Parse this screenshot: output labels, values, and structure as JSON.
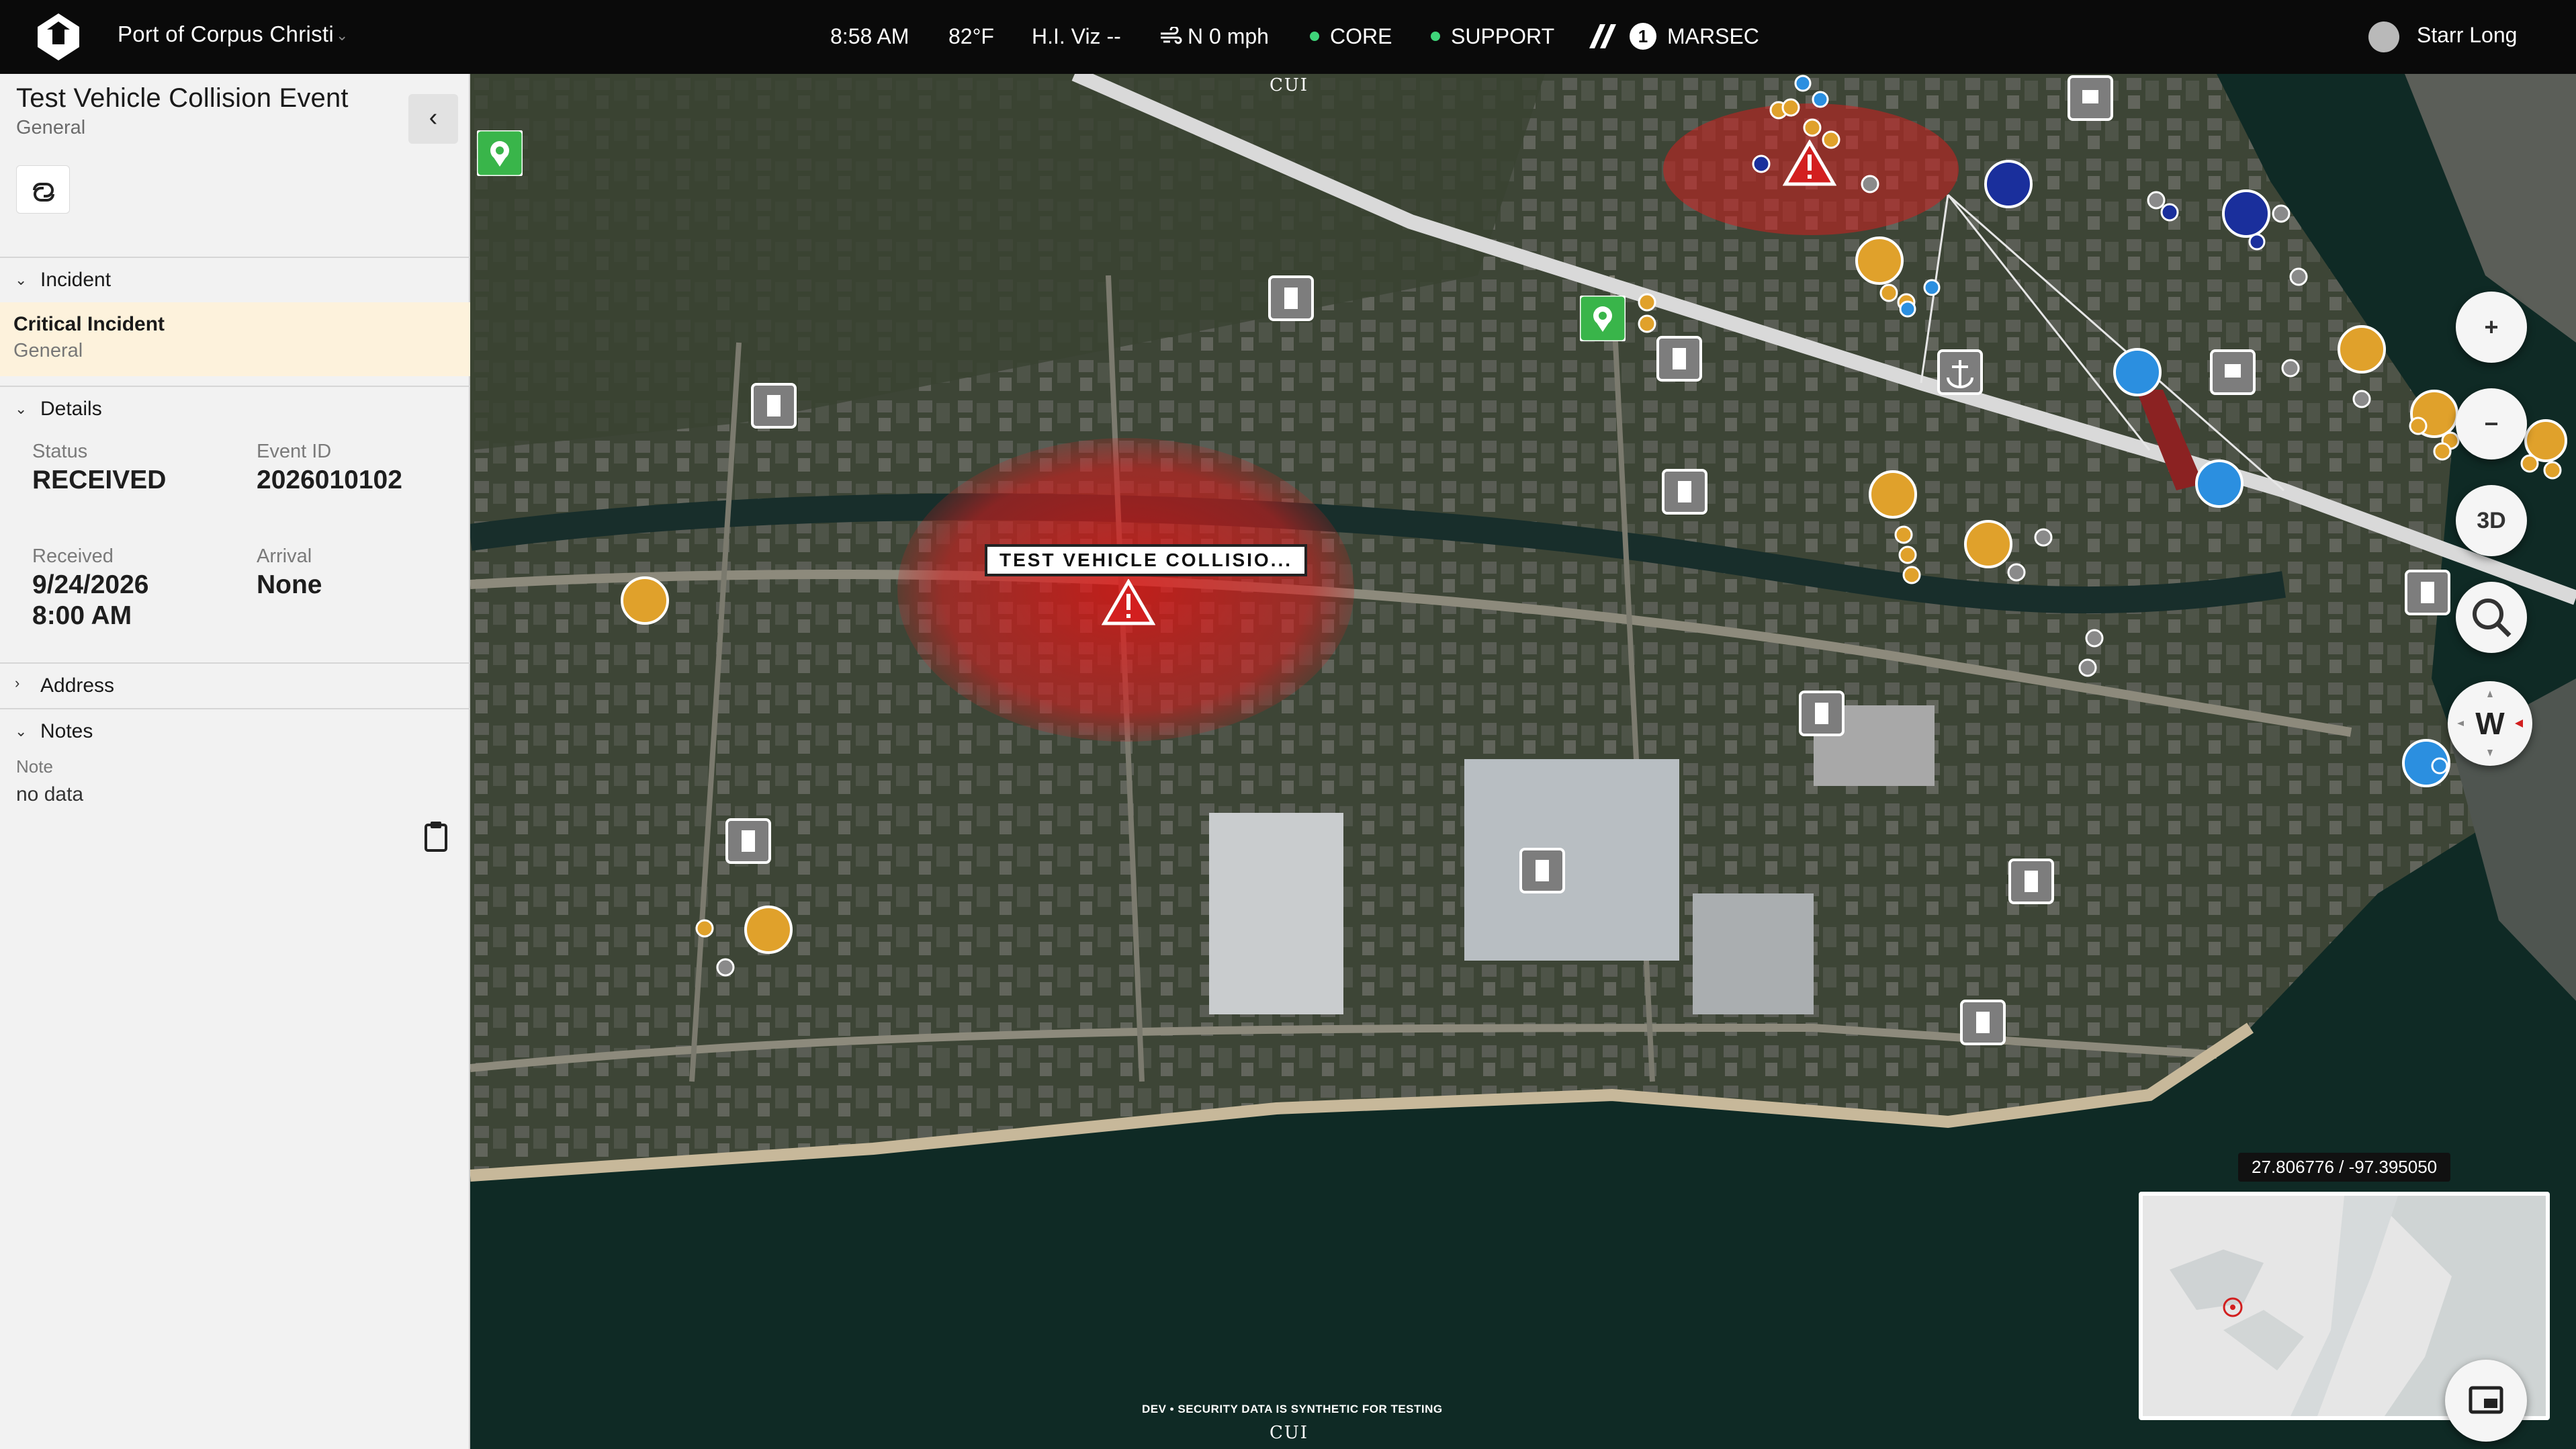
{
  "header": {
    "org_name": "Port of Corpus Christi",
    "time": "8:58 AM",
    "temperature": "82°F",
    "visibility": "H.I. Viz --",
    "wind": "N 0 mph",
    "core_label": "CORE",
    "support_label": "SUPPORT",
    "marsec_level": "1",
    "marsec_label": "MARSEC",
    "user_name": "Starr Long"
  },
  "panel": {
    "title": "Test Vehicle Collision Event",
    "subtitle": "General",
    "sections": {
      "incident": "Incident",
      "details": "Details",
      "address": "Address",
      "notes": "Notes"
    },
    "incident": {
      "name": "Critical Incident",
      "type": "General"
    },
    "details": {
      "status_label": "Status",
      "status_value": "RECEIVED",
      "event_id_label": "Event ID",
      "event_id_value": "2026010102",
      "received_label": "Received",
      "received_date": "9/24/2026",
      "received_time": "8:00 AM",
      "arrival_label": "Arrival",
      "arrival_value": "None"
    },
    "notes": {
      "label": "Note",
      "value": "no data"
    }
  },
  "map": {
    "classification_marking": "CUI",
    "incident_callout": "TEST VEHICLE COLLISIO...",
    "coordinates": "27.806776 / -97.395050",
    "view_mode_label": "3D",
    "compass_heading": "W",
    "dev_notice": "DEV • SECURITY DATA IS SYNTHETIC FOR TESTING",
    "colors": {
      "alert_zone": "#d21f1f",
      "gold_marker": "#e0a12b",
      "blue_marker": "#2b8fe0",
      "green_marker": "#39b54a",
      "grey_marker": "#7d7d7d"
    }
  }
}
